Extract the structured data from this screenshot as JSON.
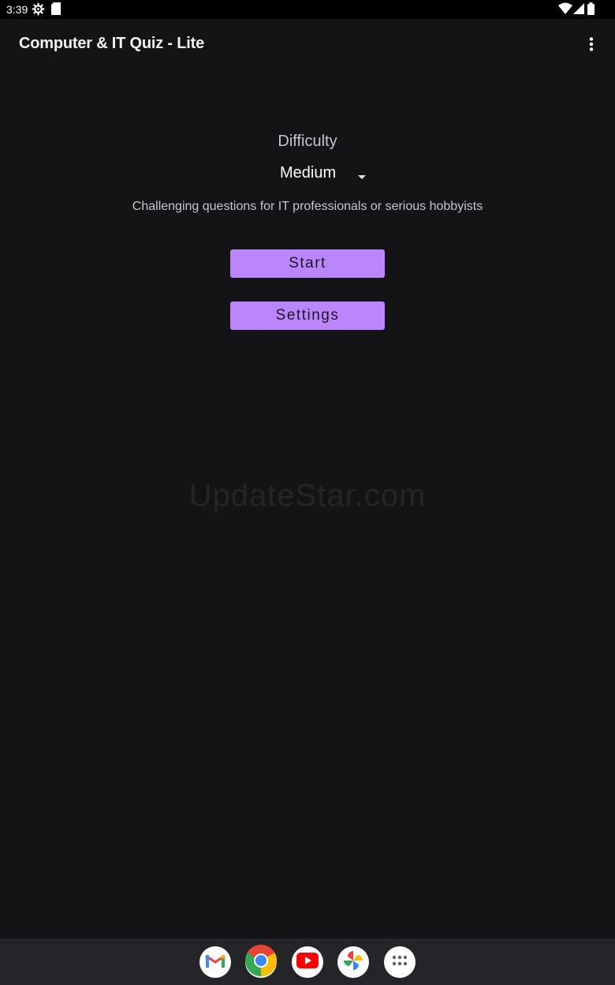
{
  "status_bar": {
    "time": "3:39",
    "icons": [
      "settings-icon",
      "sd-card-icon",
      "wifi-icon",
      "signal-icon",
      "battery-icon"
    ]
  },
  "app_bar": {
    "title": "Computer & IT Quiz - Lite",
    "overflow_icon": "more-vert-icon"
  },
  "main": {
    "difficulty_label": "Difficulty",
    "difficulty_selected": "Medium",
    "difficulty_description": "Challenging questions for IT professionals or serious hobbyists",
    "start_label": "Start",
    "settings_label": "Settings"
  },
  "watermark": "UpdateStar.com",
  "dock": {
    "apps": [
      "gmail-icon",
      "chrome-icon",
      "youtube-icon",
      "photos-icon",
      "app-drawer-icon"
    ]
  },
  "colors": {
    "background": "#141315",
    "button": "#bb86fc",
    "navbar": "#252428"
  }
}
